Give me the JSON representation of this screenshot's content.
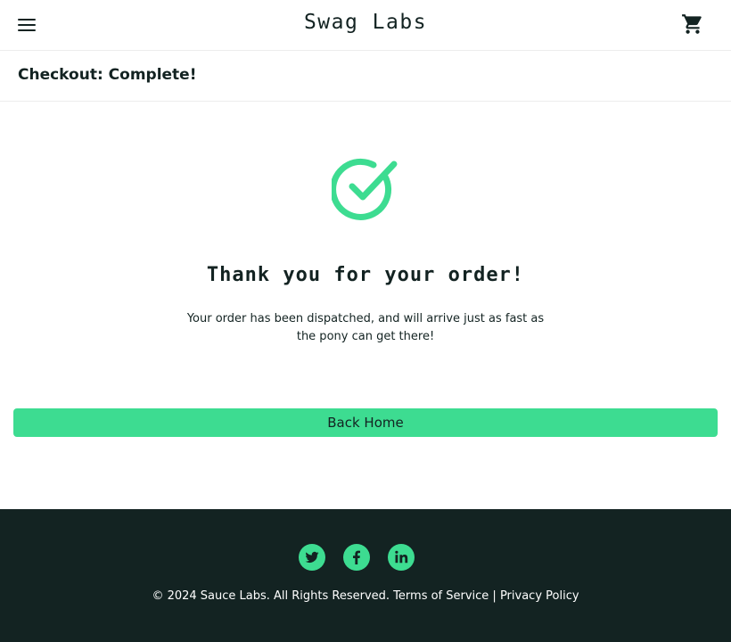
{
  "header": {
    "logo": "Swag Labs",
    "menu_icon": "hamburger-menu-icon",
    "cart_icon": "shopping-cart-icon"
  },
  "subheader": {
    "title": "Checkout: Complete!"
  },
  "complete": {
    "icon": "checkmark-circle-icon",
    "header": "Thank you for your order!",
    "text": "Your order has been dispatched, and will arrive just as fast as the pony can get there!",
    "back_button": "Back Home"
  },
  "footer": {
    "social": [
      "twitter-icon",
      "facebook-icon",
      "linkedin-icon"
    ],
    "copy": "© 2024 Sauce Labs. All Rights Reserved. Terms of Service | Privacy Policy"
  },
  "colors": {
    "accent": "#3ddc91",
    "text": "#132322",
    "footer_bg": "#132322"
  }
}
